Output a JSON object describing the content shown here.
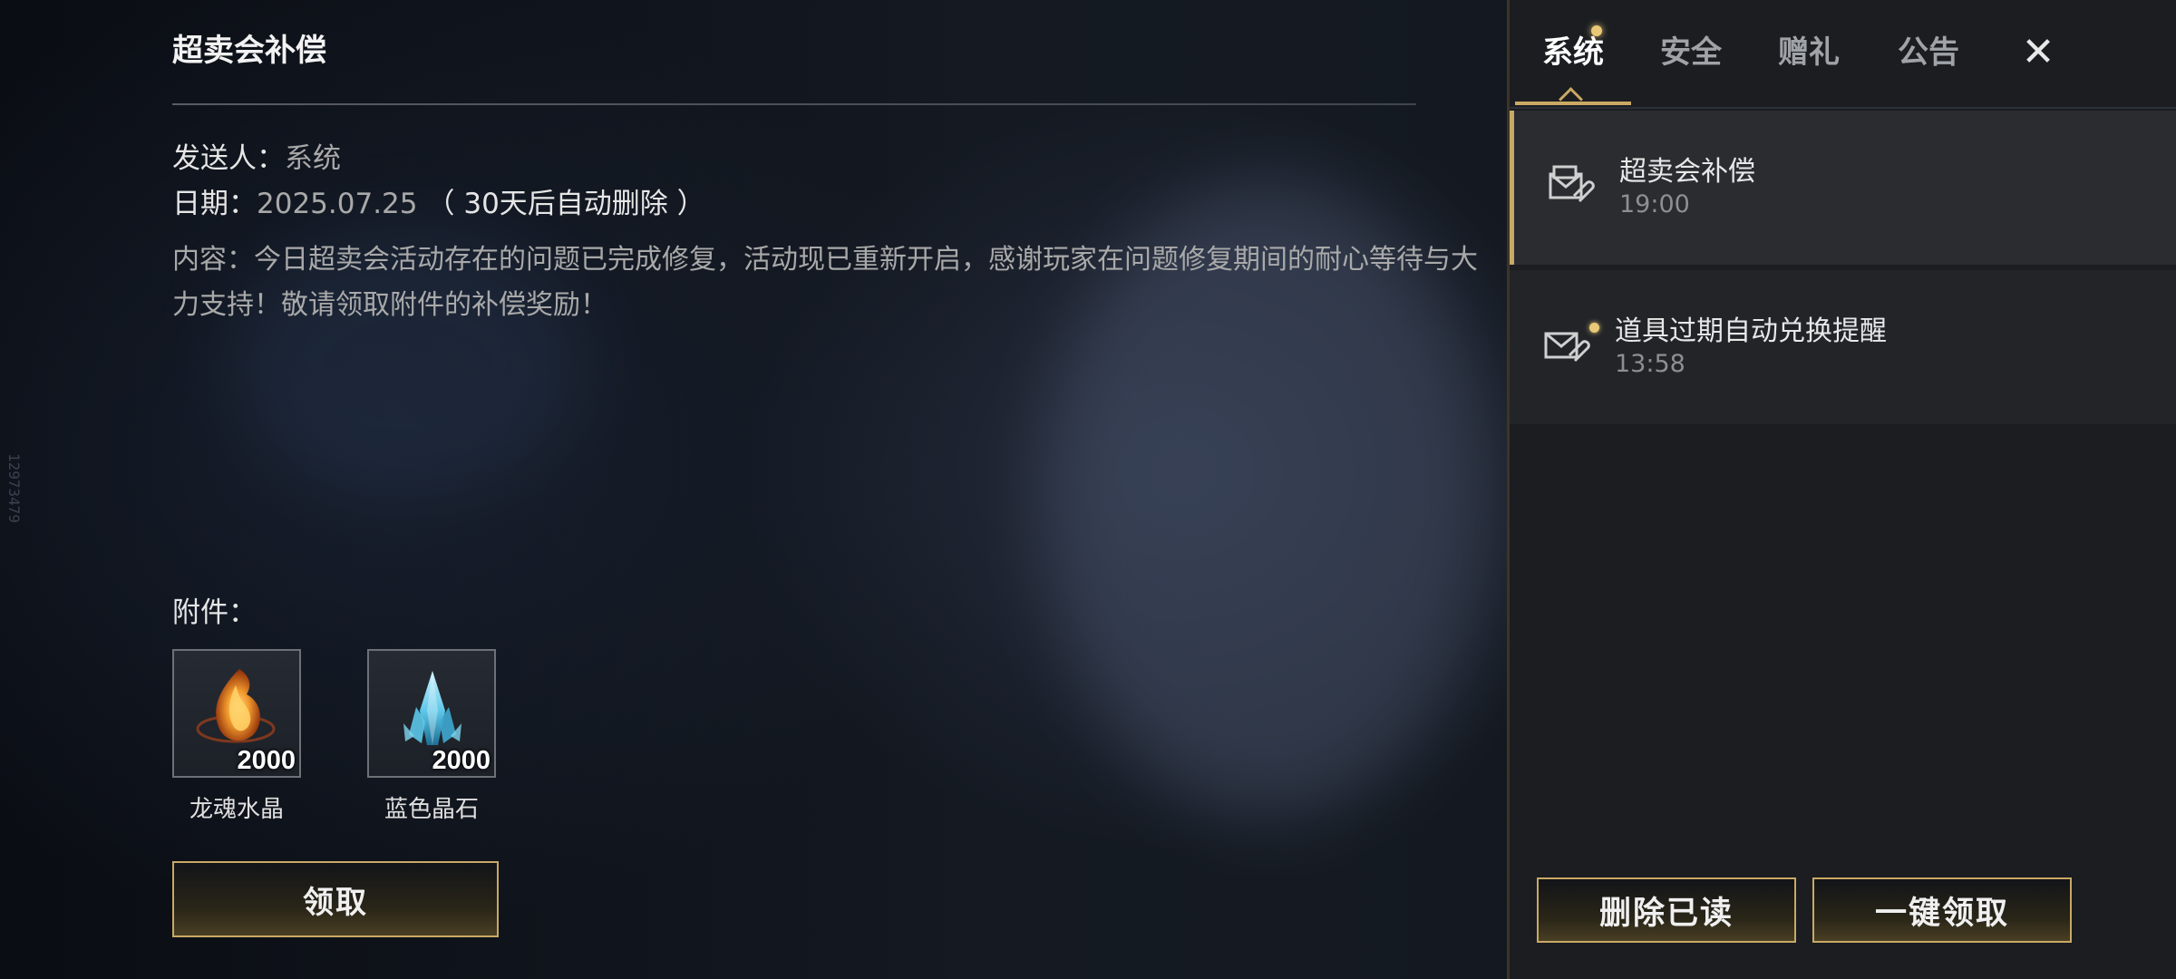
{
  "side_id": "12973479",
  "detail": {
    "title": "超卖会补偿",
    "sender_label": "发送人：",
    "sender": "系统",
    "date_label": "日期：",
    "date": "2025.07.25",
    "date_note": "（ 30天后自动删除 ）",
    "content_label": "内容：",
    "content": "今日超卖会活动存在的问题已完成修复，活动现已重新开启，感谢玩家在问题修复期间的耐心等待与大力支持！敬请领取附件的补偿奖励！",
    "attachments_label": "附件：",
    "attachments": [
      {
        "name": "龙魂水晶",
        "count": "2000",
        "icon": "dragon-soul-crystal-icon"
      },
      {
        "name": "蓝色晶石",
        "count": "2000",
        "icon": "blue-gem-icon"
      }
    ],
    "claim_label": "领取"
  },
  "tabs": {
    "items": [
      "系统",
      "安全",
      "赠礼",
      "公告"
    ],
    "active_index": 0,
    "close_symbol": "✕"
  },
  "mails": [
    {
      "title": "超卖会补偿",
      "time": "19:00",
      "selected": true,
      "unread": false
    },
    {
      "title": "道具过期自动兑换提醒",
      "time": "13:58",
      "selected": false,
      "unread": true
    }
  ],
  "actions": {
    "delete_read": "删除已读",
    "claim_all": "一键领取"
  },
  "colors": {
    "accent_gold": "#c9a964",
    "unread_dot": "#e9c978"
  }
}
